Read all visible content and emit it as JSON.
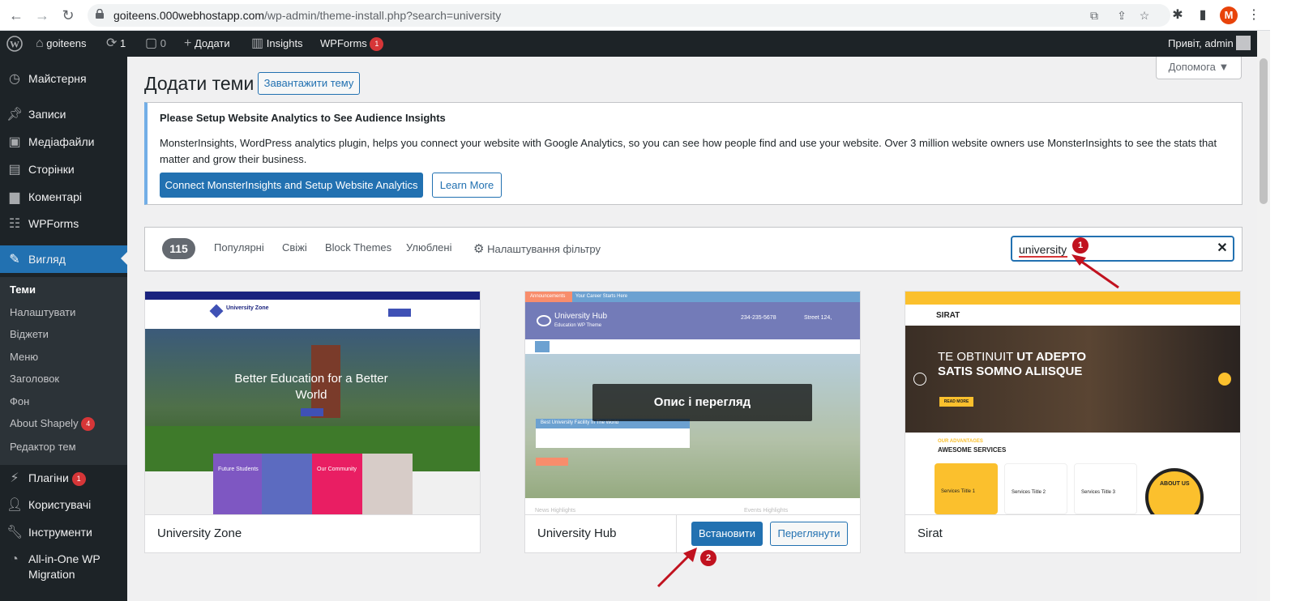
{
  "browser": {
    "url_host": "goiteens.000webhostapp.com",
    "url_path": "/wp-admin/theme-install.php?search=university",
    "profile_initial": "M"
  },
  "adminbar": {
    "site_name": "goiteens",
    "updates_count": "1",
    "comments_count": "0",
    "add_new_label": "Додати",
    "insights_label": "Insights",
    "wpforms_label": "WPForms",
    "wpforms_badge": "1",
    "greeting": "Привіт, admin"
  },
  "sidebar": {
    "items": [
      {
        "label": "Майстерня",
        "icon": "dashboard-icon"
      },
      {
        "label": "Записи",
        "icon": "pin-icon"
      },
      {
        "label": "Медіафайли",
        "icon": "media-icon"
      },
      {
        "label": "Сторінки",
        "icon": "pages-icon"
      },
      {
        "label": "Коментарі",
        "icon": "comment-icon"
      },
      {
        "label": "WPForms",
        "icon": "forms-icon"
      },
      {
        "label": "Вигляд",
        "icon": "brush-icon"
      },
      {
        "label": "Плагіни",
        "icon": "plugin-icon",
        "badge": "1"
      },
      {
        "label": "Користувачі",
        "icon": "users-icon"
      },
      {
        "label": "Інструменти",
        "icon": "tools-icon"
      },
      {
        "label": "All-in-One WP Migration",
        "icon": "migration-icon"
      }
    ],
    "submenu": [
      {
        "label": "Теми"
      },
      {
        "label": "Налаштувати"
      },
      {
        "label": "Віджети"
      },
      {
        "label": "Меню"
      },
      {
        "label": "Заголовок"
      },
      {
        "label": "Фон"
      },
      {
        "label": "About Shapely",
        "badge": "4"
      },
      {
        "label": "Редактор тем"
      }
    ]
  },
  "main": {
    "title": "Додати теми",
    "upload_button": "Завантажити тему",
    "help_button": "Допомога ▼",
    "notice": {
      "title": "Please Setup Website Analytics to See Audience Insights",
      "text": "MonsterInsights, WordPress analytics plugin, helps you connect your website with Google Analytics, so you can see how people find and use your website. Over 3 million website owners use MonsterInsights to see the stats that matter and grow their business.",
      "primary_button": "Connect MonsterInsights and Setup Website Analytics",
      "secondary_button": "Learn More"
    },
    "filter": {
      "count": "115",
      "links": [
        "Популярні",
        "Свіжі",
        "Block Themes",
        "Улюблені"
      ],
      "feature_filter": "Налаштування фільтру",
      "search_value": "university"
    },
    "themes": [
      {
        "name": "University Zone",
        "hero_text": "Better Education for a Better World",
        "logo_text": "University Zone",
        "box1_title": "Future Students",
        "box2_title": "Our Community"
      },
      {
        "name": "University Hub",
        "overlay_text": "Опис і перегляд",
        "install_button": "Встановити",
        "preview_button": "Переглянути",
        "logo_text": "University Hub",
        "logo_sub": "Education WP Theme",
        "caption": "Best University Facility In The World",
        "phone": "234-235-5678",
        "address": "Street 124,",
        "topbar_label": "Announcements",
        "topbar_text": "Your Career Starts Here",
        "footer_left": "News Highlights",
        "footer_right": "Events Highlights"
      },
      {
        "name": "Sirat",
        "logo_text": "SIRAT",
        "hero_line1": "TE OBTINUIT",
        "hero_line1b": "UT ADEPTO",
        "hero_line2": "SATIS SOMNO ALIISQUE",
        "read_more": "READ MORE",
        "advantages_label": "OUR ADVANTAGES",
        "services_heading": "AWESOME SERVICES",
        "service1": "Services Tiitle 1",
        "service2": "Services Tiitle 2",
        "service3": "Services Tiitle 3",
        "about_us": "ABOUT US"
      }
    ]
  },
  "annotations": {
    "step1": "1",
    "step2": "2",
    "color": "#c1121f"
  }
}
